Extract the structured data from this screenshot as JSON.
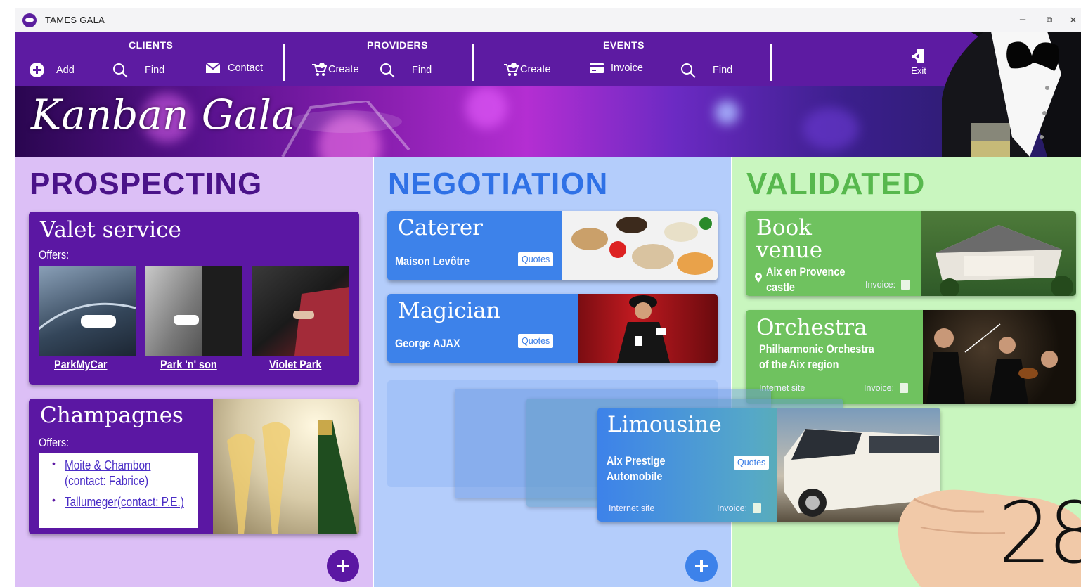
{
  "window": {
    "title": "TAMES GALA",
    "controls": {
      "minimize": "–",
      "restore": "⧉",
      "close": "✕"
    }
  },
  "toolbar": {
    "clients": {
      "title": "CLIENTS",
      "add": "Add",
      "find": "Find",
      "contact": "Contact"
    },
    "providers": {
      "title": "PROVIDERS",
      "create": "Create",
      "find": "Find"
    },
    "events": {
      "title": "EVENTS",
      "create": "Create",
      "invoice": "Invoice",
      "find": "Find"
    },
    "exit": "Exit"
  },
  "banner": {
    "brand": "Kanban Gala"
  },
  "columns": {
    "prospecting": {
      "title": "PROSPECTING",
      "valet": {
        "title": "Valet service",
        "offers_label": "Offers:",
        "providers": [
          "ParkMyCar",
          "Park 'n' son",
          "Violet Park"
        ]
      },
      "champagnes": {
        "title": "Champagnes",
        "offers_label": "Offers:",
        "items": [
          "Moite & Chambon (contact: Fabrice)",
          "Tallumeger(contact: P.E.)"
        ]
      }
    },
    "negotiation": {
      "title": "NEGOTIATION",
      "caterer": {
        "title": "Caterer",
        "provider": "Maison Levôtre",
        "quotes": "Quotes"
      },
      "magician": {
        "title": "Magician",
        "provider": "George AJAX",
        "quotes": "Quotes"
      }
    },
    "validated": {
      "title": "VALIDATED",
      "venue": {
        "title_line1": "Book",
        "title_line2": "venue",
        "location_line1": "Aix en Provence",
        "location_line2": "castle",
        "invoice": "Invoice:"
      },
      "orchestra": {
        "title": "Orchestra",
        "provider_line1": "Philharmonic Orchestra",
        "provider_line2": "of the Aix region",
        "site": "Internet site",
        "invoice": "Invoice:"
      }
    }
  },
  "dragging": {
    "limousine": {
      "title": "Limousine",
      "provider_line1": "Aix Prestige",
      "provider_line2": "Automobile",
      "quotes": "Quotes",
      "site": "Internet site",
      "invoice": "Invoice:"
    }
  },
  "watermark": "28",
  "colors": {
    "toolbar": "#5d1ba2",
    "prospecting_bg": "#dcbff6",
    "negotiation_bg": "#b4cdfb",
    "validated_bg": "#c9f6bf",
    "purple_card": "#5b17a3",
    "blue_card": "#3d82ea",
    "green_card": "#6fc25f"
  }
}
